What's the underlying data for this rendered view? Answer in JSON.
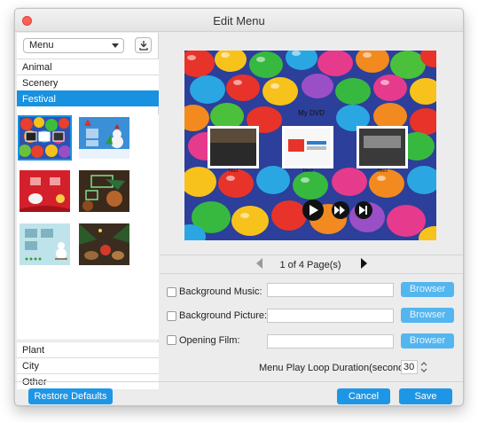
{
  "window": {
    "title": "Edit Menu"
  },
  "left_panel": {
    "select_value": "Menu",
    "categories_top": [
      "Animal",
      "Scenery",
      "Festival"
    ],
    "categories_bottom": [
      "Plant",
      "City",
      "Other"
    ],
    "selected_category": "Festival",
    "download_icon": "download-icon"
  },
  "preview": {
    "menu_title": "My DVD",
    "titles": [
      "Title1",
      "Title2",
      "Title3"
    ]
  },
  "pager": {
    "text": "1 of 4 Page(s)"
  },
  "options": {
    "background_music": {
      "label": "Background Music:",
      "checked": false,
      "value": "",
      "button": "Browser"
    },
    "background_picture": {
      "label": "Background Picture:",
      "checked": false,
      "value": "",
      "button": "Browser"
    },
    "opening_film": {
      "label": "Opening Film:",
      "checked": false,
      "value": "",
      "button": "Browser"
    }
  },
  "loop": {
    "label": "Menu Play Loop Duration(seconds):",
    "value": "30"
  },
  "footer": {
    "restore": "Restore Defaults",
    "cancel": "Cancel",
    "save": "Save"
  },
  "colors": {
    "accent": "#1891e0",
    "browser_button": "#54b6ef",
    "close": "#fe5f57"
  }
}
